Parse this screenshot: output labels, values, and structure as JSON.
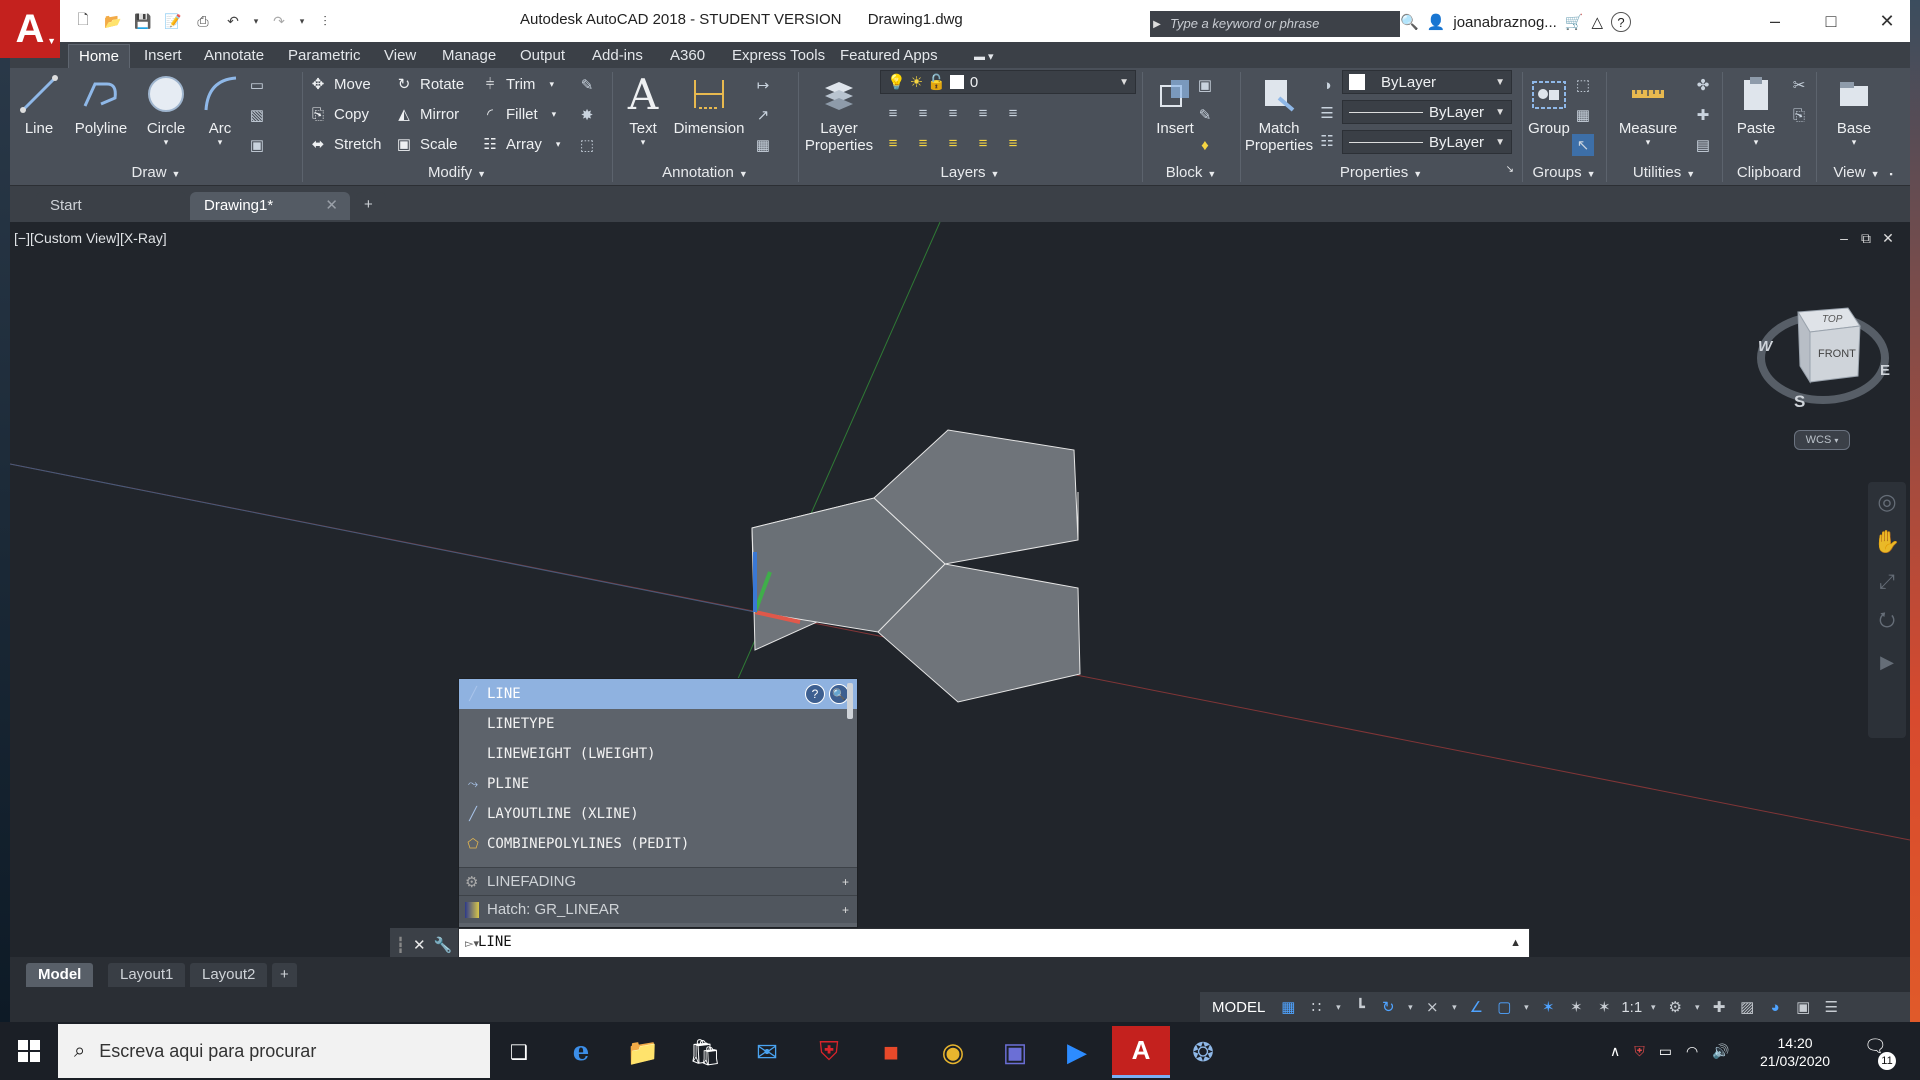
{
  "window": {
    "title": "Autodesk AutoCAD 2018 - STUDENT VERSION",
    "document_name": "Drawing1.dwg",
    "search_placeholder": "Type a keyword or phrase",
    "user_name": "joanabraznog..."
  },
  "ribbon_tabs": [
    "Home",
    "Insert",
    "Annotate",
    "Parametric",
    "View",
    "Manage",
    "Output",
    "Add-ins",
    "A360",
    "Express Tools",
    "Featured Apps"
  ],
  "ribbon": {
    "draw": {
      "title": "Draw",
      "line": "Line",
      "polyline": "Polyline",
      "circle": "Circle",
      "arc": "Arc"
    },
    "modify": {
      "title": "Modify",
      "move": "Move",
      "rotate": "Rotate",
      "trim": "Trim",
      "copy": "Copy",
      "mirror": "Mirror",
      "fillet": "Fillet",
      "stretch": "Stretch",
      "scale": "Scale",
      "array": "Array"
    },
    "annotation": {
      "title": "Annotation",
      "text": "Text",
      "dimension": "Dimension"
    },
    "layers": {
      "title": "Layers",
      "layer_properties_1": "Layer",
      "layer_properties_2": "Properties",
      "current_layer": "0"
    },
    "block": {
      "title": "Block",
      "insert": "Insert"
    },
    "properties": {
      "title": "Properties",
      "match_1": "Match",
      "match_2": "Properties",
      "color": "ByLayer",
      "linetype": "ByLayer",
      "lineweight": "ByLayer"
    },
    "groups": {
      "title": "Groups",
      "group": "Group"
    },
    "utilities": {
      "title": "Utilities",
      "measure": "Measure"
    },
    "clipboard": {
      "title": "Clipboard",
      "paste": "Paste"
    },
    "view": {
      "title": "View",
      "base": "Base"
    }
  },
  "doc_tabs": {
    "start": "Start",
    "drawing": "Drawing1*"
  },
  "viewport": {
    "label": "[−][Custom View][X-Ray]",
    "viewcube": {
      "top": "TOP",
      "front": "FRONT",
      "w": "W",
      "e": "E",
      "s": "S",
      "wcs": "WCS"
    }
  },
  "autocomplete": {
    "items": [
      "LINE",
      "LINETYPE",
      "LINEWEIGHT (LWEIGHT)",
      "PLINE",
      "LAYOUTLINE (XLINE)",
      "COMBINEPOLYLINES (PEDIT)"
    ],
    "sections": [
      "LINEFADING",
      "Hatch: GR_LINEAR"
    ]
  },
  "command_line": {
    "value": "LINE"
  },
  "layout_tabs": [
    "Model",
    "Layout1",
    "Layout2"
  ],
  "status_bar": {
    "model": "MODEL",
    "scale": "1:1"
  },
  "taskbar": {
    "search_placeholder": "Escreva aqui para procurar",
    "time": "14:20",
    "date": "21/03/2020",
    "notification_count": "11"
  }
}
